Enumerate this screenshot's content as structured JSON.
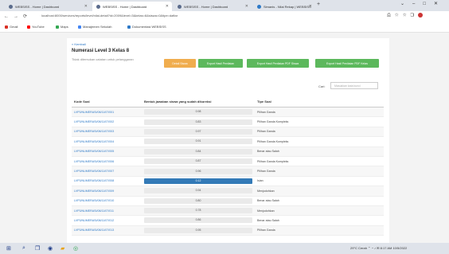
{
  "browser": {
    "tabs": [
      {
        "label": "WEBSISS - Home | Dashboard"
      },
      {
        "label": "WEBSISS - Home | Dashboard"
      },
      {
        "label": "WEBSISS - Home | Dashboard"
      },
      {
        "label": "Simanis - Nilai Rekap | WEBSISS"
      }
    ],
    "url": "localhost:8000/services/reports/level/nilai-detail?id=2009&level=3&kelas=8&siswa=0&tipe=daftar",
    "bookmarks": [
      "Gmail",
      "YouTube",
      "Maps",
      "Manajemen Sekolah",
      "Dokumentasi WEBSISS"
    ]
  },
  "page": {
    "back_link": "« Kembali",
    "title": "Numerasi Level 3 Kelas 8",
    "subtitle": "Tidak ditemukan catatan untuk pelanggaran",
    "buttons": [
      {
        "label": "Detail Siswa",
        "color": "#f0ad4e"
      },
      {
        "label": "Export Hasil Penilaian",
        "color": "#5cb85c"
      },
      {
        "label": "Export Hasil Penilaian PDF Siswa",
        "color": "#5cb85c"
      },
      {
        "label": "Export Hasil Penilaian PDF Kelas",
        "color": "#5cb85c"
      }
    ],
    "search": {
      "label": "Cari:",
      "placeholder": "Masukkan kata kunci"
    }
  },
  "table": {
    "headers": [
      "Kode Soal",
      "Bentuk jawaban siswa yang sudah dikoreksi",
      "Tipe Soal"
    ],
    "rows": [
      {
        "code": "LVP3/NUMERASI/08/11/07/001",
        "value": "0.98",
        "progress": 0,
        "type": "Pilihan Ganda"
      },
      {
        "code": "LVP3/NUMERASI/08/11/07/002",
        "value": "0.83",
        "progress": 0,
        "type": "Pilihan Ganda Kompleks"
      },
      {
        "code": "LVP3/NUMERASI/08/11/07/003",
        "value": "0.97",
        "progress": 0,
        "type": "Pilihan Ganda"
      },
      {
        "code": "LVP3/NUMERASI/08/11/07/004",
        "value": "0.91",
        "progress": 0,
        "type": "Pilihan Ganda Kompleks"
      },
      {
        "code": "LVP3/NUMERASI/08/11/07/005",
        "value": "0.84",
        "progress": 0,
        "type": "Benar atau Salah"
      },
      {
        "code": "LVP3/NUMERASI/08/11/07/006",
        "value": "0.87",
        "progress": 0,
        "type": "Pilihan Ganda Kompleks"
      },
      {
        "code": "LVP3/NUMERASI/08/11/07/007",
        "value": "0.96",
        "progress": 0,
        "type": "Pilihan Ganda"
      },
      {
        "code": "LVP3/NUMERASI/08/11/07/008",
        "value": "0.12",
        "progress": 1,
        "type": "Isian"
      },
      {
        "code": "LVP3/NUMERASI/08/11/07/009",
        "value": "0.94",
        "progress": 0,
        "type": "Menjodohkan"
      },
      {
        "code": "LVP3/NUMERASI/08/11/07/010",
        "value": "0.80",
        "progress": 0,
        "type": "Benar atau Salah"
      },
      {
        "code": "LVP3/NUMERASI/08/11/07/011",
        "value": "0.78",
        "progress": 0,
        "type": "Menjodohkan"
      },
      {
        "code": "LVP3/NUMERASI/08/11/07/012",
        "value": "0.86",
        "progress": 0,
        "type": "Benar atau Salah"
      },
      {
        "code": "LVP3/NUMERASI/08/11/07/013",
        "value": "0.95",
        "progress": 0,
        "type": "Pilihan Ganda"
      }
    ]
  },
  "taskbar": {
    "weather": "29°C Cerah",
    "time": "8:17 AM",
    "date": "10/5/2022"
  },
  "icons": [
    "windows-icon",
    "search-icon",
    "task-view-icon",
    "edge-icon",
    "explorer-icon",
    "chrome-icon"
  ]
}
